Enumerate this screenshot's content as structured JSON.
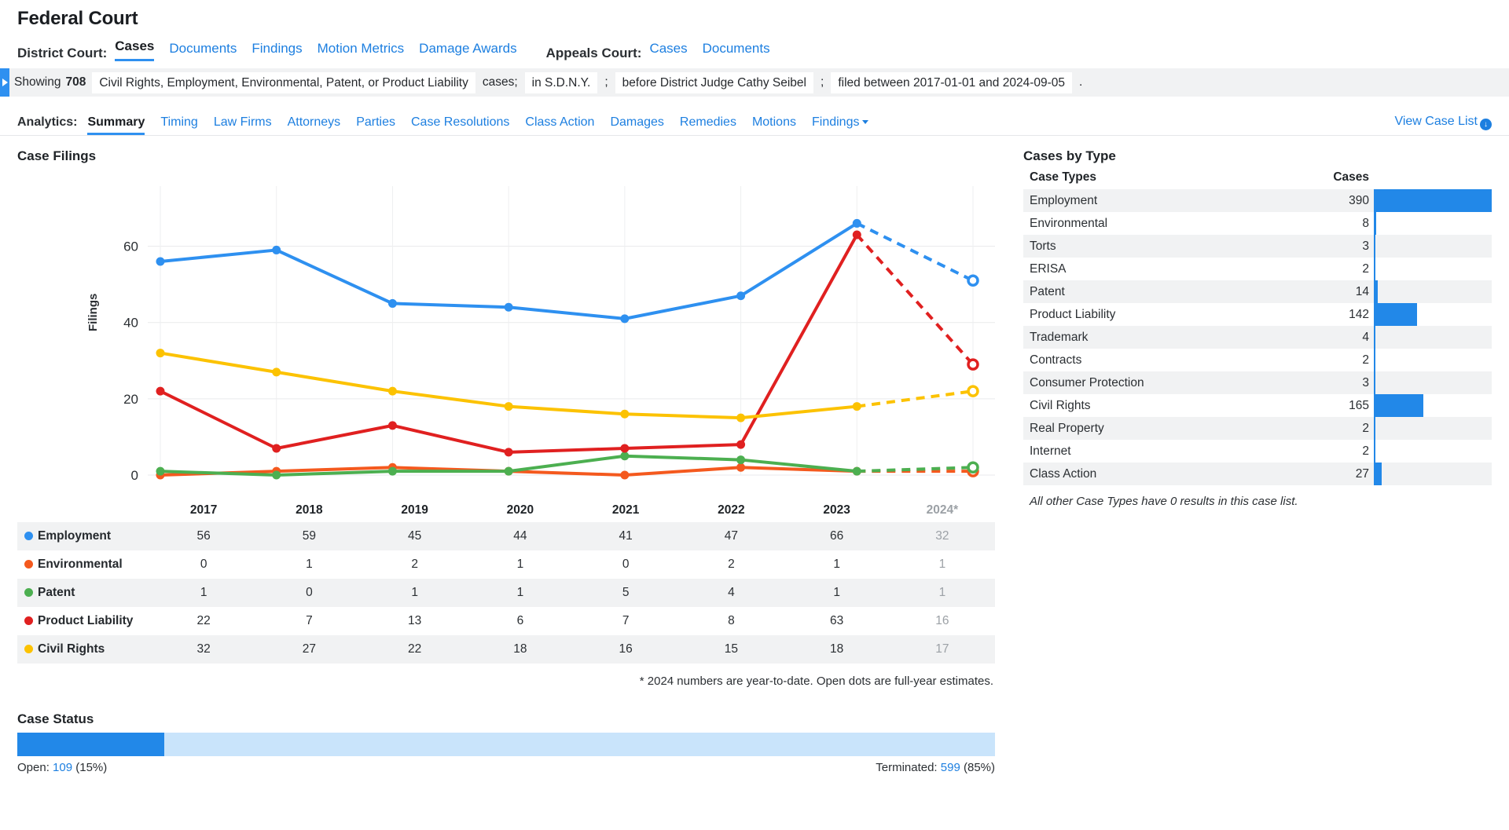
{
  "header": {
    "title": "Federal Court",
    "district_label": "District Court:",
    "district_links": [
      {
        "label": "Cases",
        "active": true
      },
      {
        "label": "Documents",
        "active": false
      },
      {
        "label": "Findings",
        "active": false
      },
      {
        "label": "Motion Metrics",
        "active": false
      },
      {
        "label": "Damage Awards",
        "active": false
      }
    ],
    "appeals_label": "Appeals Court:",
    "appeals_links": [
      {
        "label": "Cases",
        "active": false
      },
      {
        "label": "Documents",
        "active": false
      }
    ]
  },
  "filter_bar": {
    "toggle_icon": "triangle-right-icon",
    "showing_label": "Showing",
    "count": "708",
    "case_types_chip": "Civil Rights, Employment, Environmental, Patent, or Product Liability",
    "cases_word": "cases;",
    "court_chip": "in S.D.N.Y.",
    "sep1": ";",
    "judge_chip": "before District Judge Cathy Seibel",
    "sep2": ";",
    "date_chip": "filed between 2017-01-01 and 2024-09-05",
    "end_period": "."
  },
  "analytics": {
    "label": "Analytics:",
    "tabs": [
      {
        "label": "Summary",
        "active": true,
        "caret": false
      },
      {
        "label": "Timing",
        "active": false,
        "caret": false
      },
      {
        "label": "Law Firms",
        "active": false,
        "caret": false
      },
      {
        "label": "Attorneys",
        "active": false,
        "caret": false
      },
      {
        "label": "Parties",
        "active": false,
        "caret": false
      },
      {
        "label": "Case Resolutions",
        "active": false,
        "caret": false
      },
      {
        "label": "Class Action",
        "active": false,
        "caret": false
      },
      {
        "label": "Damages",
        "active": false,
        "caret": false
      },
      {
        "label": "Remedies",
        "active": false,
        "caret": false
      },
      {
        "label": "Motions",
        "active": false,
        "caret": false
      },
      {
        "label": "Findings",
        "active": false,
        "caret": true
      }
    ],
    "view_case_list": "View Case List",
    "view_case_list_icon": "download-circle-icon"
  },
  "case_filings": {
    "title": "Case Filings",
    "note": "* 2024 numbers are year-to-date. Open dots are full-year estimates."
  },
  "chart_data": {
    "type": "line",
    "title": "Case Filings",
    "xlabel": "",
    "ylabel": "Filings",
    "categories": [
      "2017",
      "2018",
      "2019",
      "2020",
      "2021",
      "2022",
      "2023",
      "2024*"
    ],
    "ylim": [
      0,
      70
    ],
    "yticks": [
      0,
      20,
      40,
      60
    ],
    "grid": true,
    "legend_position": "table-below",
    "estimate_index": 7,
    "series": [
      {
        "name": "Employment",
        "color": "#2e90f0",
        "values": [
          56,
          59,
          45,
          44,
          41,
          47,
          66,
          32
        ],
        "estimate_value": 51
      },
      {
        "name": "Environmental",
        "color": "#f4591e",
        "values": [
          0,
          1,
          2,
          1,
          0,
          2,
          1,
          1
        ],
        "estimate_value": 1
      },
      {
        "name": "Patent",
        "color": "#4caf50",
        "values": [
          1,
          0,
          1,
          1,
          5,
          4,
          1,
          1
        ],
        "estimate_value": 2
      },
      {
        "name": "Product Liability",
        "color": "#e02020",
        "values": [
          22,
          7,
          13,
          6,
          7,
          8,
          63,
          16
        ],
        "estimate_value": 29
      },
      {
        "name": "Civil Rights",
        "color": "#fcc200",
        "values": [
          32,
          27,
          22,
          18,
          16,
          15,
          18,
          17
        ],
        "estimate_value": 22
      }
    ]
  },
  "cases_by_type": {
    "title": "Cases by Type",
    "col_type": "Case Types",
    "col_cases": "Cases",
    "max": 390,
    "rows": [
      {
        "type": "Employment",
        "cases": "390"
      },
      {
        "type": "Environmental",
        "cases": "8"
      },
      {
        "type": "Torts",
        "cases": "3"
      },
      {
        "type": "ERISA",
        "cases": "2"
      },
      {
        "type": "Patent",
        "cases": "14"
      },
      {
        "type": "Product Liability",
        "cases": "142"
      },
      {
        "type": "Trademark",
        "cases": "4"
      },
      {
        "type": "Contracts",
        "cases": "2"
      },
      {
        "type": "Consumer Protection",
        "cases": "3"
      },
      {
        "type": "Civil Rights",
        "cases": "165"
      },
      {
        "type": "Real Property",
        "cases": "2"
      },
      {
        "type": "Internet",
        "cases": "2"
      },
      {
        "type": "Class Action",
        "cases": "27"
      }
    ],
    "note": "All other Case Types have 0 results in this case list."
  },
  "case_status": {
    "title": "Case Status",
    "open_label": "Open:",
    "open_count": "109",
    "open_pct": "(15%)",
    "open_pct_value": 15,
    "terminated_label": "Terminated:",
    "terminated_count": "599",
    "terminated_pct": "(85%)"
  },
  "colors": {
    "accent": "#2e90f0",
    "link": "#1d7fe0",
    "bar": "#2288e8",
    "bar_track": "#c9e4fb",
    "row_alt": "#f1f2f3"
  }
}
